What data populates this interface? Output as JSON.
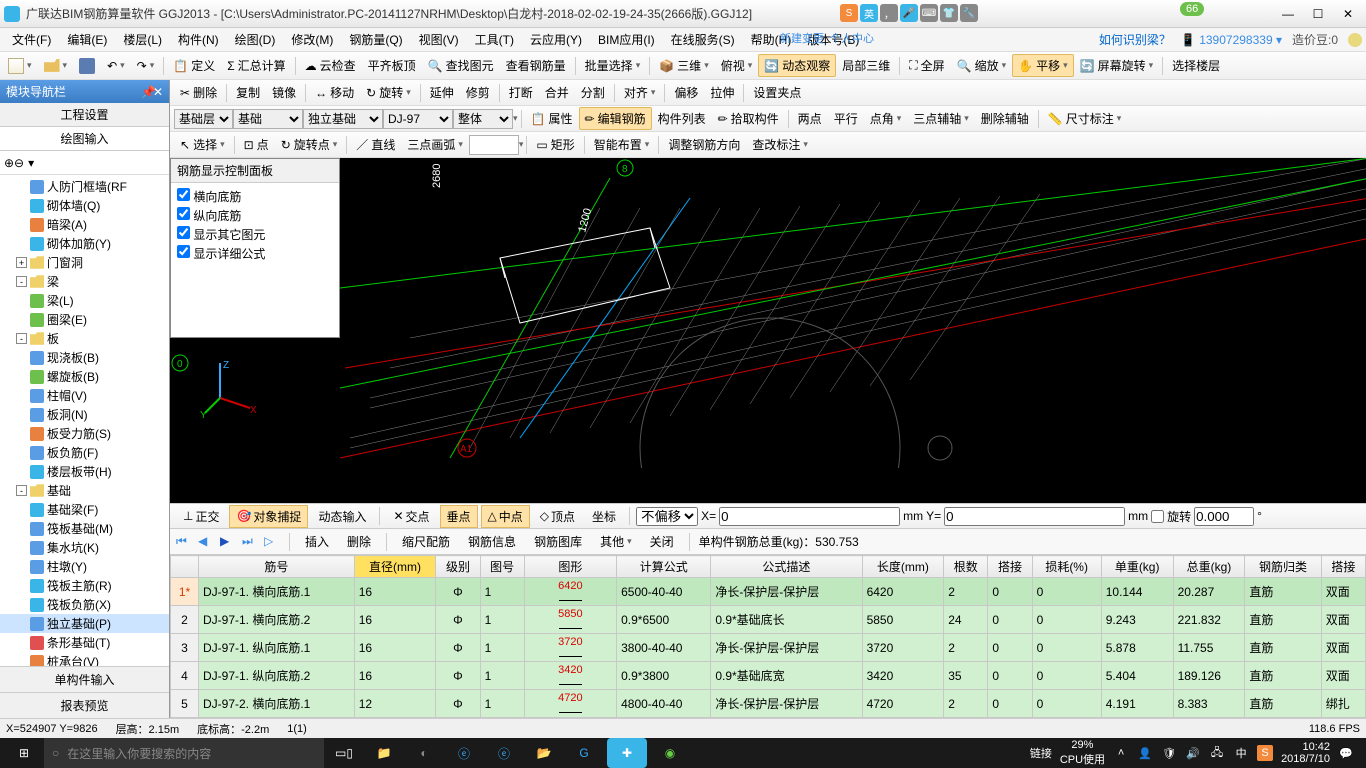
{
  "titlebar": {
    "app": "广联达BIM钢筋算量软件 GGJ2013 - [C:\\Users\\Administrator.PC-20141127NRHM\\Desktop\\白龙村-2018-02-02-19-24-35(2666版).GGJ12]",
    "badge": "66"
  },
  "menubar": {
    "items": [
      "文件(F)",
      "编辑(E)",
      "楼层(L)",
      "构件(N)",
      "绘图(D)",
      "修改(M)",
      "钢筋量(Q)",
      "视图(V)",
      "工具(T)",
      "云应用(Y)",
      "BIM应用(I)",
      "在线服务(S)",
      "帮助(H)",
      "版本号(B)"
    ],
    "howto": "如何识别梁？",
    "phone": "13907298339",
    "bean_label": "造价豆:0"
  },
  "ribbon_extra": {
    "new": "新建变更",
    "center": "个人中心"
  },
  "tool1": {
    "define": "定义",
    "sum": "汇总计算",
    "cloud": "云检查",
    "flat": "平齐板顶",
    "findg": "查找图元",
    "findr": "查看钢筋量",
    "batch": "批量选择",
    "v3d": "三维",
    "pv": "俯视",
    "dyn": "动态观察",
    "p3d": "局部三维",
    "full": "全屏",
    "zoom": "缩放",
    "pan": "平移",
    "rot": "屏幕旋转",
    "floor": "选择楼层"
  },
  "tool2": {
    "del": "删除",
    "copy": "复制",
    "mirror": "镜像",
    "move": "移动",
    "rotate": "旋转",
    "extend": "延伸",
    "trim": "修剪",
    "break": "打断",
    "merge": "合并",
    "split": "分割",
    "align": "对齐",
    "offset": "偏移",
    "stretch": "拉伸",
    "setclip": "设置夹点"
  },
  "tool3": {
    "layer": "基础层",
    "type": "基础",
    "sub": "独立基础",
    "item": "DJ-97",
    "whole": "整体",
    "attr": "属性",
    "editr": "编辑钢筋",
    "list": "构件列表",
    "pick": "拾取构件",
    "two": "两点",
    "par": "平行",
    "ptang": "点角",
    "axis3": "三点辅轴",
    "delaxis": "删除辅轴",
    "dim": "尺寸标注"
  },
  "tool4": {
    "select": "选择",
    "point": "点",
    "rotpt": "旋转点",
    "line": "直线",
    "arc3": "三点画弧",
    "rect": "矩形",
    "smart": "智能布置",
    "adjdir": "调整钢筋方向",
    "annot": "查改标注"
  },
  "leftpanel": {
    "title": "模块导航栏",
    "tab1": "工程设置",
    "tab2": "绘图输入",
    "tree": [
      {
        "ind": 2,
        "ic": "blue",
        "t": "人防门框墙(RF"
      },
      {
        "ind": 2,
        "ic": "cyan",
        "t": "砌体墙(Q)"
      },
      {
        "ind": 2,
        "ic": "orange",
        "t": "暗梁(A)"
      },
      {
        "ind": 2,
        "ic": "cyan",
        "t": "砌体加筋(Y)"
      },
      {
        "ind": 1,
        "tog": "+",
        "ic": "folder",
        "t": "门窗洞"
      },
      {
        "ind": 1,
        "tog": "-",
        "ic": "folder",
        "t": "梁"
      },
      {
        "ind": 2,
        "ic": "green",
        "t": "梁(L)"
      },
      {
        "ind": 2,
        "ic": "green",
        "t": "圈梁(E)"
      },
      {
        "ind": 1,
        "tog": "-",
        "ic": "folder",
        "t": "板"
      },
      {
        "ind": 2,
        "ic": "blue",
        "t": "现浇板(B)"
      },
      {
        "ind": 2,
        "ic": "green",
        "t": "螺旋板(B)"
      },
      {
        "ind": 2,
        "ic": "blue",
        "t": "柱帽(V)"
      },
      {
        "ind": 2,
        "ic": "blue",
        "t": "板洞(N)"
      },
      {
        "ind": 2,
        "ic": "orange",
        "t": "板受力筋(S)"
      },
      {
        "ind": 2,
        "ic": "blue",
        "t": "板负筋(F)"
      },
      {
        "ind": 2,
        "ic": "cyan",
        "t": "楼层板带(H)"
      },
      {
        "ind": 1,
        "tog": "-",
        "ic": "folder",
        "t": "基础"
      },
      {
        "ind": 2,
        "ic": "cyan",
        "t": "基础梁(F)"
      },
      {
        "ind": 2,
        "ic": "blue",
        "t": "筏板基础(M)"
      },
      {
        "ind": 2,
        "ic": "blue",
        "t": "集水坑(K)"
      },
      {
        "ind": 2,
        "ic": "blue",
        "t": "柱墩(Y)"
      },
      {
        "ind": 2,
        "ic": "cyan",
        "t": "筏板主筋(R)"
      },
      {
        "ind": 2,
        "ic": "cyan",
        "t": "筏板负筋(X)"
      },
      {
        "ind": 2,
        "ic": "blue",
        "t": "独立基础(P)",
        "sel": true
      },
      {
        "ind": 2,
        "ic": "red",
        "t": "条形基础(T)"
      },
      {
        "ind": 2,
        "ic": "orange",
        "t": "桩承台(V)"
      },
      {
        "ind": 2,
        "ic": "cyan",
        "t": "承台梁(F)"
      },
      {
        "ind": 2,
        "ic": "blue",
        "t": "桩(U)"
      },
      {
        "ind": 2,
        "ic": "cyan",
        "t": "基础板带(W)"
      }
    ],
    "foot1": "单构件输入",
    "foot2": "报表预览"
  },
  "rebar_panel": {
    "title": "钢筋显示控制面板",
    "opts": [
      "横向底筋",
      "纵向底筋",
      "显示其它图元",
      "显示详细公式"
    ]
  },
  "snap": {
    "ortho": "正交",
    "osnap": "对象捕捉",
    "dyn": "动态输入",
    "inter": "交点",
    "perp": "垂点",
    "mid": "中点",
    "vert": "顶点",
    "coord": "坐标",
    "nooff": "不偏移",
    "x": "X=",
    "xval": "0",
    "mm": "mm",
    "y": "Y=",
    "yval": "0",
    "rot": "旋转",
    "rotval": "0.000"
  },
  "tablebar": {
    "ins": "插入",
    "del": "删除",
    "scale": "缩尺配筋",
    "info": "钢筋信息",
    "lib": "钢筋图库",
    "other": "其他",
    "close": "关闭",
    "total": "单构件钢筋总重(kg)：530.753"
  },
  "table": {
    "headers": [
      "",
      "筋号",
      "直径(mm)",
      "级别",
      "图号",
      "图形",
      "计算公式",
      "公式描述",
      "长度(mm)",
      "根数",
      "搭接",
      "损耗(%)",
      "单重(kg)",
      "总重(kg)",
      "钢筋归类",
      "搭接"
    ],
    "rows": [
      {
        "n": "1*",
        "sel": true,
        "id": "DJ-97-1. 横向底筋.1",
        "dia": "16",
        "lvl": "Φ",
        "fig": "1",
        "shape": "6420",
        "calc": "6500-40-40",
        "desc": "净长-保护层-保护层",
        "len": "6420",
        "cnt": "2",
        "lap": "0",
        "loss": "0",
        "uw": "10.144",
        "tw": "20.287",
        "cls": "直筋",
        "j": "双面"
      },
      {
        "n": "2",
        "id": "DJ-97-1. 横向底筋.2",
        "dia": "16",
        "lvl": "Φ",
        "fig": "1",
        "shape": "5850",
        "calc": "0.9*6500",
        "desc": "0.9*基础底长",
        "len": "5850",
        "cnt": "24",
        "lap": "0",
        "loss": "0",
        "uw": "9.243",
        "tw": "221.832",
        "cls": "直筋",
        "j": "双面"
      },
      {
        "n": "3",
        "id": "DJ-97-1. 纵向底筋.1",
        "dia": "16",
        "lvl": "Φ",
        "fig": "1",
        "shape": "3720",
        "calc": "3800-40-40",
        "desc": "净长-保护层-保护层",
        "len": "3720",
        "cnt": "2",
        "lap": "0",
        "loss": "0",
        "uw": "5.878",
        "tw": "11.755",
        "cls": "直筋",
        "j": "双面"
      },
      {
        "n": "4",
        "id": "DJ-97-1. 纵向底筋.2",
        "dia": "16",
        "lvl": "Φ",
        "fig": "1",
        "shape": "3420",
        "calc": "0.9*3800",
        "desc": "0.9*基础底宽",
        "len": "3420",
        "cnt": "35",
        "lap": "0",
        "loss": "0",
        "uw": "5.404",
        "tw": "189.126",
        "cls": "直筋",
        "j": "双面"
      },
      {
        "n": "5",
        "id": "DJ-97-2. 横向底筋.1",
        "dia": "12",
        "lvl": "Φ",
        "fig": "1",
        "shape": "4720",
        "calc": "4800-40-40",
        "desc": "净长-保护层-保护层",
        "len": "4720",
        "cnt": "2",
        "lap": "0",
        "loss": "0",
        "uw": "4.191",
        "tw": "8.383",
        "cls": "直筋",
        "j": "绑扎"
      }
    ]
  },
  "statusbar": {
    "xy": "X=524907 Y=9826",
    "floor": "层高：2.15m",
    "bot": "底标高：-2.2m",
    "sel": "1(1)",
    "fps": "118.6 FPS"
  },
  "taskbar": {
    "search": "在这里输入你要搜索的内容",
    "link": "链接",
    "cpu": "29%\nCPU使用",
    "time": "10:42",
    "date": "2018/7/10",
    "ime": "中"
  },
  "ime": {
    "s": "S",
    "en": "英"
  },
  "viewport": {
    "dim1": "2680",
    "dim2": "1200",
    "axis1": "0",
    "axis2": "8",
    "axisA": "A1"
  }
}
